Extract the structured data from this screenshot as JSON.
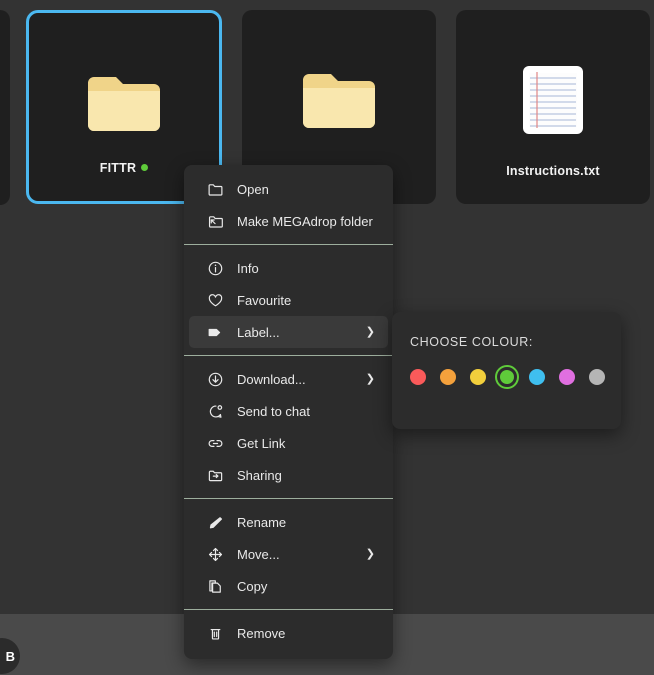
{
  "colors": {
    "app_background": "#333333",
    "tile_background": "#1f1f1f",
    "selection_outline": "#4bb8f0",
    "menu_background": "#2c2c2c",
    "menu_highlight": "#3a3a3a",
    "menu_separator": "#9dae9d",
    "bottom_bar": "#4a4a4a",
    "folder_body": "#f7e3a1",
    "folder_tab": "#f0d489",
    "text": "#e9e9e9"
  },
  "file_grid": {
    "items": [
      {
        "name": "",
        "kind": "folder",
        "selected": false,
        "label_color": "",
        "partial": true
      },
      {
        "name": "FITTR",
        "kind": "folder",
        "selected": true,
        "label_color": "#5fcb3a",
        "partial": false
      },
      {
        "name": "",
        "kind": "folder",
        "selected": false,
        "label_color": "",
        "partial": false
      },
      {
        "name": "Instructions.txt",
        "kind": "text-file",
        "selected": false,
        "label_color": "",
        "partial": false
      }
    ]
  },
  "bottom_bar": {
    "avatar_text": "B"
  },
  "context_menu": {
    "groups": [
      {
        "items": [
          {
            "label": "Open",
            "icon": "folder-open-icon",
            "submenu": false
          },
          {
            "label": "Make MEGAdrop folder",
            "icon": "megadrop-icon",
            "submenu": false
          }
        ]
      },
      {
        "items": [
          {
            "label": "Info",
            "icon": "info-icon",
            "submenu": false
          },
          {
            "label": "Favourite",
            "icon": "heart-icon",
            "submenu": false
          },
          {
            "label": "Label...",
            "icon": "tag-icon",
            "submenu": true,
            "active": true
          }
        ]
      },
      {
        "items": [
          {
            "label": "Download...",
            "icon": "download-icon",
            "submenu": true
          },
          {
            "label": "Send to chat",
            "icon": "chat-icon",
            "submenu": false
          },
          {
            "label": "Get Link",
            "icon": "link-icon",
            "submenu": false
          },
          {
            "label": "Sharing",
            "icon": "share-folder-icon",
            "submenu": false
          }
        ]
      },
      {
        "items": [
          {
            "label": "Rename",
            "icon": "pencil-icon",
            "submenu": false
          },
          {
            "label": "Move...",
            "icon": "move-arrows-icon",
            "submenu": true
          },
          {
            "label": "Copy",
            "icon": "copy-icon",
            "submenu": false
          }
        ]
      },
      {
        "items": [
          {
            "label": "Remove",
            "icon": "trash-icon",
            "submenu": false
          }
        ]
      }
    ],
    "submenu_arrow_glyph": "❯"
  },
  "colour_submenu": {
    "title": "CHOOSE COLOUR:",
    "swatches": [
      {
        "name": "red",
        "hex": "#fa5a5a",
        "selected": false
      },
      {
        "name": "orange",
        "hex": "#f4a13c",
        "selected": false
      },
      {
        "name": "yellow",
        "hex": "#f2cf3c",
        "selected": false
      },
      {
        "name": "green",
        "hex": "#5fcb3a",
        "selected": true
      },
      {
        "name": "blue",
        "hex": "#3fbfef",
        "selected": false
      },
      {
        "name": "purple",
        "hex": "#e06fe0",
        "selected": false
      },
      {
        "name": "grey",
        "hex": "#b5b5b5",
        "selected": false
      }
    ]
  }
}
